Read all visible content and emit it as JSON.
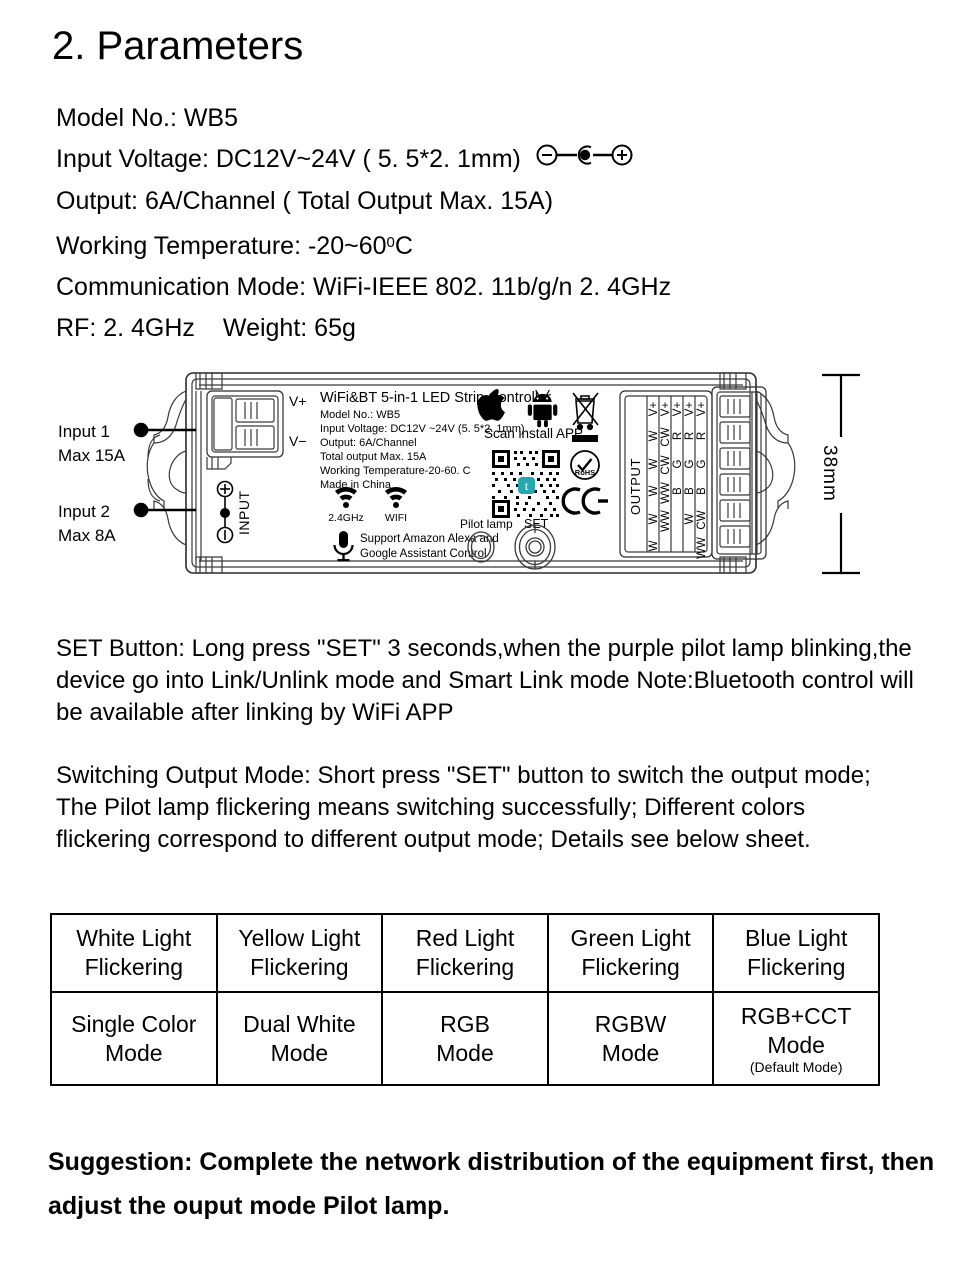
{
  "heading": "2. Parameters",
  "specs": {
    "model": "Model No.: WB5",
    "input_voltage_prefix": "Input Voltage: DC12V~24V ( 5. 5*2. 1mm)",
    "output": "Output: 6A/Channel ( Total Output Max. 15A)",
    "working_temp_prefix": "Working Temperature: -20~60",
    "working_temp_deg": "0",
    "working_temp_suffix": "C",
    "communication": "Communication Mode: WiFi-IEEE 802. 11b/g/n 2. 4GHz",
    "rf": "RF: 2. 4GHz",
    "weight": "Weight: 65g"
  },
  "device": {
    "callout_input1_line1": "Input 1",
    "callout_input1_line2": "Max 15A",
    "callout_input2_line1": "Input 2",
    "callout_input2_line2": "Max 8A",
    "dimension_height": "38mm",
    "terminal_vplus": "V+",
    "terminal_vminus": "V−",
    "input_label": "INPUT",
    "label_title": "WiFi&BT 5-in-1 LED Strip Controller",
    "label_lines": [
      "Model No.: WB5",
      "Input Voltage: DC12V ~24V (5. 5*2. 1mm)",
      "Output: 6A/Channel",
      "Total output Max. 15A",
      "Working Temperature-20-60. C",
      "Made in China"
    ],
    "scan_install": "Scan install APP",
    "wifi_24_label": "2.4GHz",
    "wifi_label": "WIFI",
    "voice_line1": "Support Amazon Alexa and",
    "voice_line2": "Google Assistant Control",
    "pilot_lamp_label": "Pilot lamp",
    "set_label": "SET",
    "rohs_label": "RoHS",
    "output_label": "OUTPUT",
    "output_columns": [
      [
        "V+",
        "W",
        "W",
        "W",
        "W",
        "W"
      ],
      [
        "V+",
        "CW",
        "CW",
        "WW",
        "WW",
        ""
      ],
      [
        "V+",
        "R",
        "G",
        "B",
        "",
        ""
      ],
      [
        "V+",
        "R",
        "G",
        "B",
        "W",
        ""
      ],
      [
        "V+",
        "R",
        "G",
        "B",
        "CW",
        "WW"
      ]
    ]
  },
  "paragraphs": {
    "set_button": "SET Button: Long press \"SET\" 3 seconds,when the purple pilot lamp blinking,the device go into Link/Unlink mode and Smart Link mode Note:Bluetooth control will be available after linking by WiFi APP",
    "switching_output": "Switching Output Mode: Short press \"SET\" button to switch the output mode; The Pilot lamp flickering means switching successfully; Different colors flickering correspond to different output mode; Details see below sheet."
  },
  "mode_table": {
    "flicker_row": [
      "White Light\nFlickering",
      "Yellow Light\nFlickering",
      "Red Light\nFlickering",
      "Green Light\nFlickering",
      "Blue  Light\nFlickering"
    ],
    "mode_row": [
      "Single Color\nMode",
      "Dual White\nMode",
      "RGB\nMode",
      "RGBW\nMode",
      "RGB+CCT\nMode"
    ],
    "default_note": "(Default Mode)"
  },
  "suggestion": "Suggestion:  Complete the network distribution of the equipment first, then adjust the ouput mode Pilot lamp."
}
